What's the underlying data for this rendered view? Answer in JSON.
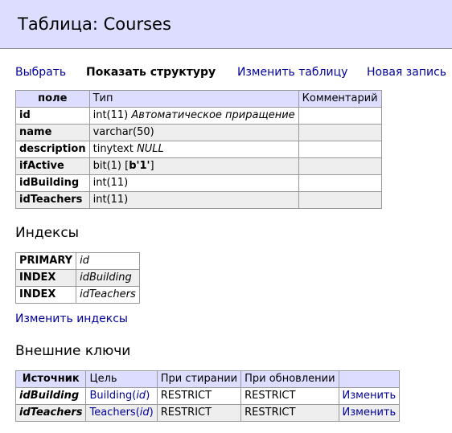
{
  "header": {
    "title": "Таблица: Courses"
  },
  "tabs": [
    {
      "label": "Выбрать"
    },
    {
      "label": "Показать структуру"
    },
    {
      "label": "Изменить таблицу"
    },
    {
      "label": "Новая запись"
    }
  ],
  "columns": {
    "headers": [
      "поле",
      "Тип",
      "Комментарий"
    ],
    "rows": [
      {
        "field": "id",
        "type": "int(11)",
        "type_extra": "Автоматическое приращение",
        "default": "",
        "comment": ""
      },
      {
        "field": "name",
        "type": "varchar(50)",
        "type_extra": "",
        "default": "",
        "comment": ""
      },
      {
        "field": "description",
        "type": "tinytext",
        "type_extra": "NULL",
        "default": "",
        "comment": ""
      },
      {
        "field": "ifActive",
        "type": "bit(1)",
        "type_extra": "",
        "default": "b'1'",
        "comment": ""
      },
      {
        "field": "idBuilding",
        "type": "int(11)",
        "type_extra": "",
        "default": "",
        "comment": ""
      },
      {
        "field": "idTeachers",
        "type": "int(11)",
        "type_extra": "",
        "default": "",
        "comment": ""
      }
    ]
  },
  "indexes": {
    "title": "Индексы",
    "rows": [
      {
        "type": "PRIMARY",
        "column": "id"
      },
      {
        "type": "INDEX",
        "column": "idBuilding"
      },
      {
        "type": "INDEX",
        "column": "idTeachers"
      }
    ],
    "edit_link": "Изменить индексы"
  },
  "foreign_keys": {
    "title": "Внешние ключи",
    "headers": [
      "Источник",
      "Цель",
      "При стирании",
      "При обновлении"
    ],
    "rows": [
      {
        "source": "idBuilding",
        "target_table": "Building",
        "target_col": "id",
        "on_delete": "RESTRICT",
        "on_update": "RESTRICT",
        "action": "Изменить"
      },
      {
        "source": "idTeachers",
        "target_table": "Teachers",
        "target_col": "id",
        "on_delete": "RESTRICT",
        "on_update": "RESTRICT",
        "action": "Изменить"
      }
    ]
  }
}
